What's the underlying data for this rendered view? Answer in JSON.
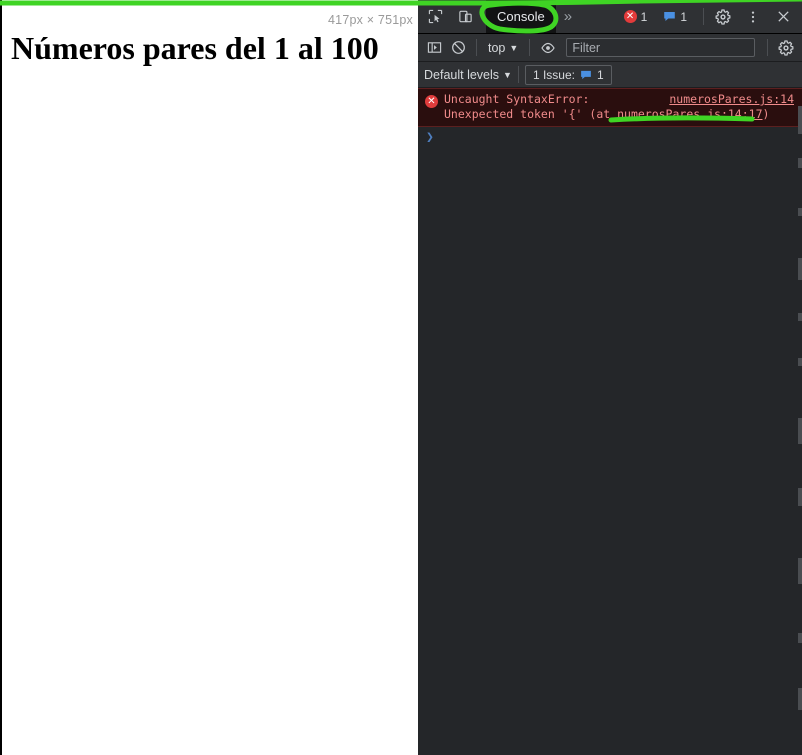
{
  "page": {
    "viewport_size_label": "417px × 751px",
    "heading": "Números pares del 1 al 100"
  },
  "devtools": {
    "tabstrip": {
      "inspect_icon": "inspect-cursor-icon",
      "device_toolbar_icon": "device-toolbar-icon",
      "tabs": [
        {
          "label": "Console",
          "active": true
        }
      ],
      "overflow_label": "»",
      "error_count": "1",
      "message_count": "1",
      "settings_icon": "gear-icon",
      "more_icon": "kebab-menu-icon",
      "close_icon": "close-icon"
    },
    "console_toolbar": {
      "sidebar_icon": "console-sidebar-icon",
      "clear_icon": "clear-console-icon",
      "context_label": "top",
      "context_caret": "▼",
      "eye_icon": "live-expression-eye-icon",
      "filter_placeholder": "Filter",
      "filter_value": "",
      "settings_icon": "gear-icon"
    },
    "levels_bar": {
      "levels_label": "Default levels",
      "levels_caret": "▼",
      "issues_label": "1 Issue:",
      "issues_icon": "issues-speech-bubble-icon",
      "issues_count": "1"
    },
    "console_output": {
      "error": {
        "icon": "error-circle-icon",
        "line1_text": "Uncaught SyntaxError:",
        "line1_link": "numerosPares.js:14",
        "line2_prefix": "Unexpected token '{' (at ",
        "line2_link": "numerosPares.js:14:17",
        "line2_suffix": ")"
      },
      "prompt_chevron": "❯"
    }
  },
  "annotations": {
    "color": "#3fd424",
    "marks": [
      "circle-around-console-tab",
      "top-stroke",
      "underline-error-link"
    ]
  },
  "colors": {
    "devtools_bg": "#242629",
    "toolbar_bg": "#2f3134",
    "active_tab_bg": "#121314",
    "error_bg": "#2a0e0e",
    "error_text": "#f08b8b",
    "annotation_green": "#3fd424",
    "page_bg": "#ffffff"
  }
}
